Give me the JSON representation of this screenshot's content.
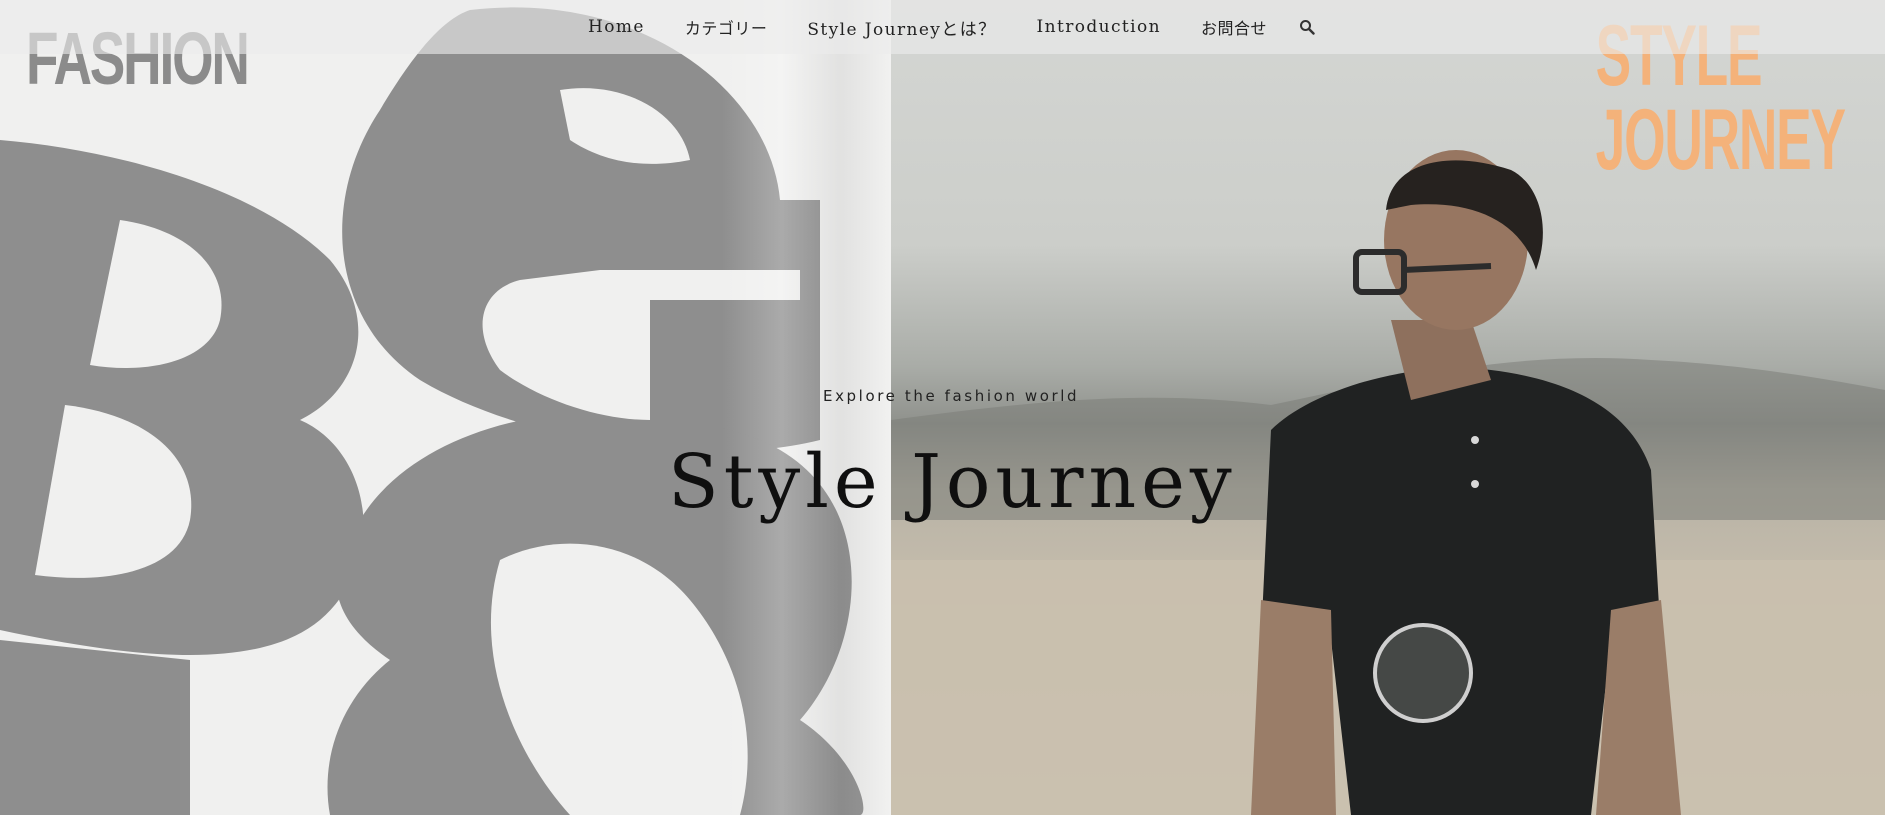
{
  "nav": {
    "items": [
      {
        "label": "Home"
      },
      {
        "label": "カテゴリー"
      },
      {
        "label": "Style Journeyとは？"
      },
      {
        "label": "Introduction"
      },
      {
        "label": "お問合せ"
      }
    ],
    "search_icon": "search-icon"
  },
  "poster": {
    "fashion_word": "FASHION",
    "logo_line1": "STYLE",
    "logo_line2": "JOURNEY"
  },
  "hero": {
    "tagline": "Explore the fashion world",
    "title": "Style Journey"
  },
  "colors": {
    "nav_bg": "#ebebeb",
    "letter_gray": "#8b8b8b",
    "logo_orange": "#f4b27a",
    "title_text": "#0f0f0f"
  }
}
